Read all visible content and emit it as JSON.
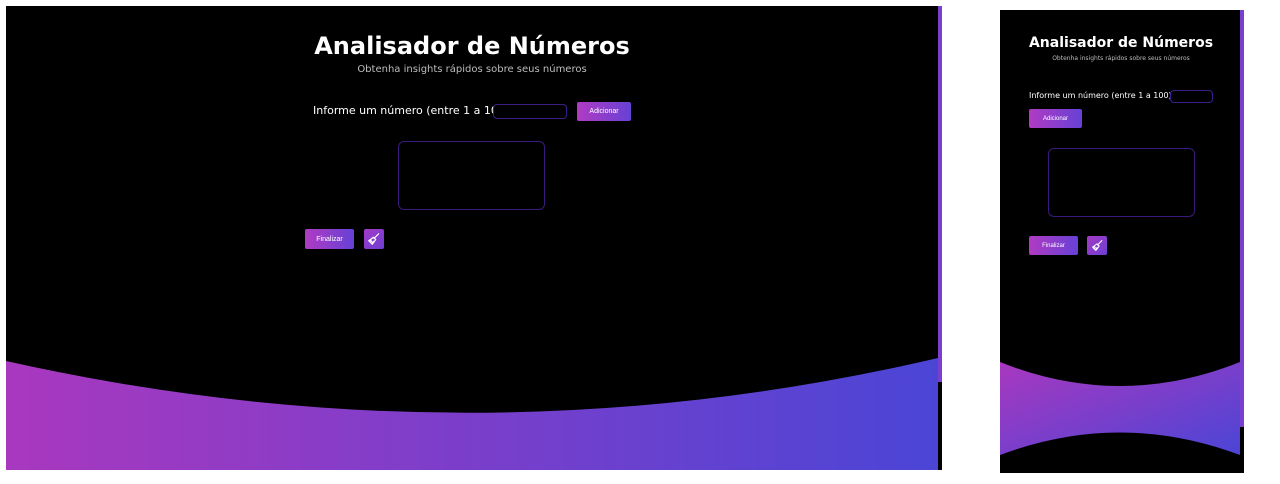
{
  "app": {
    "title": "Analisador de Números",
    "subtitle": "Obtenha insights rápidos sobre seus números"
  },
  "form": {
    "label": "Informe um número (entre 1 a 100):",
    "input_value": "",
    "add_label": "Adicionar"
  },
  "results": {
    "items": []
  },
  "actions": {
    "finish_label": "Finalizar",
    "clear_icon": "broom-icon"
  },
  "colors": {
    "background": "#000000",
    "gradient_start": "#b03bc2",
    "gradient_end": "#4b45d6",
    "input_border": "#3c1f86",
    "subtitle": "#bdbdbd"
  }
}
